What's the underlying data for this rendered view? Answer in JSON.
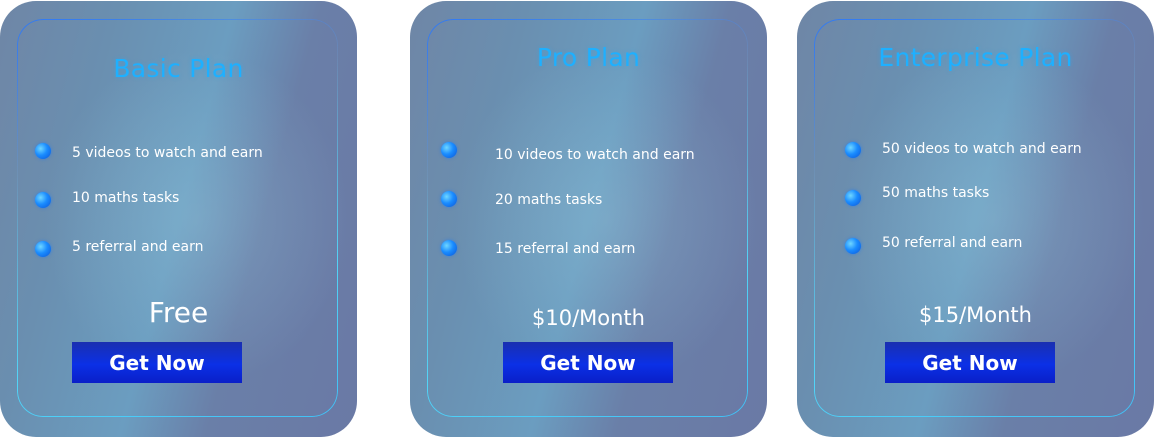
{
  "plans": [
    {
      "title": "Basic Plan",
      "features": [
        "5 videos to watch and earn",
        "10 maths tasks",
        "5 referral and earn"
      ],
      "price": "Free",
      "cta_label": "Get Now"
    },
    {
      "title": "Pro Plan",
      "features": [
        "10 videos to watch and earn",
        "20 maths tasks",
        "15 referral and earn"
      ],
      "price": "$10/Month",
      "cta_label": "Get Now"
    },
    {
      "title": "Enterprise Plan",
      "features": [
        "50 videos to watch and earn",
        "50 maths tasks",
        "50 referral and earn"
      ],
      "price": "$15/Month",
      "cta_label": "Get Now"
    }
  ],
  "colors": {
    "title": "#1eb0ff",
    "button": "#0b30e6",
    "bullet": "#1a8cff",
    "text": "#ffffff"
  }
}
